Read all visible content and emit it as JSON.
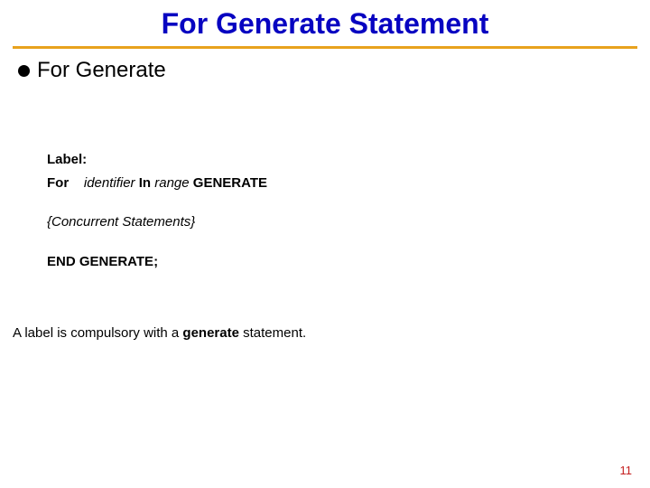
{
  "title": "For Generate Statement",
  "bullet": {
    "text": "For Generate"
  },
  "code": {
    "line1_label": "Label:",
    "line2_for": "For",
    "line2_identifier": "identifier",
    "line2_in": "In",
    "line2_range": "range",
    "line2_generate": "GENERATE",
    "line3": "{Concurrent Statements}",
    "line4": "END GENERATE;"
  },
  "note": {
    "prefix": "A label is compulsory with a ",
    "keyword": "generate",
    "suffix": " statement."
  },
  "page_number": "11"
}
